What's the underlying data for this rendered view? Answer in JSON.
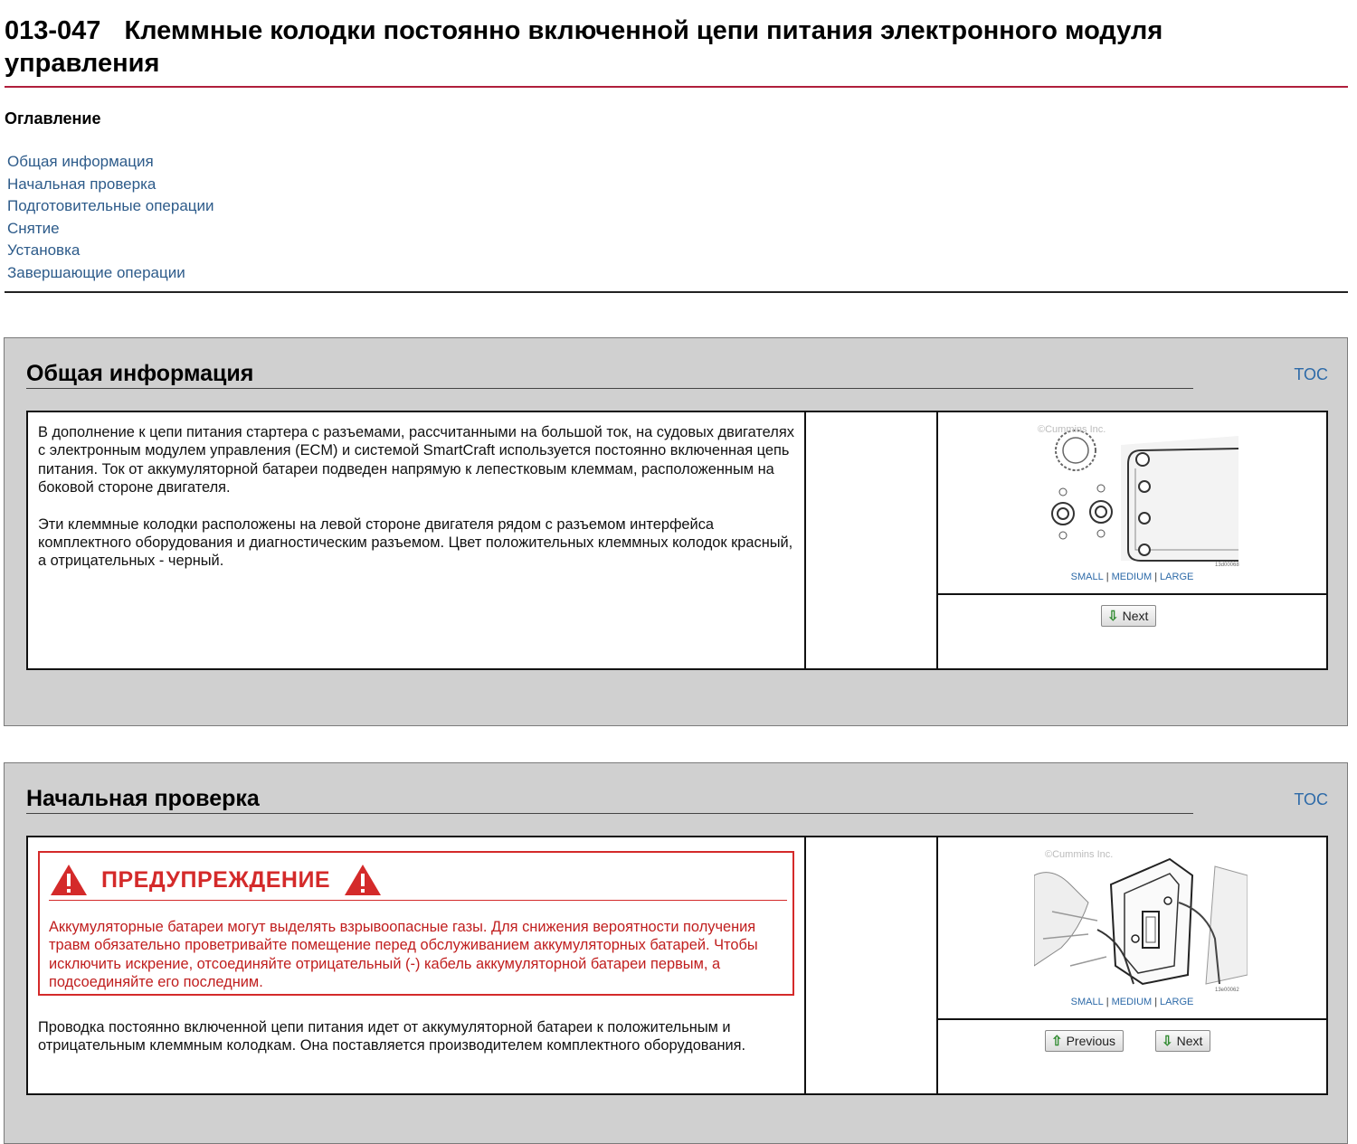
{
  "document": {
    "code": "013-047",
    "title": "Клеммные колодки постоянно включенной цепи питания электронного модуля управления"
  },
  "toc": {
    "heading": "Оглавление",
    "items": [
      {
        "label": "Общая информация"
      },
      {
        "label": "Начальная проверка"
      },
      {
        "label": "Подготовительные операции"
      },
      {
        "label": "Снятие"
      },
      {
        "label": "Установка"
      },
      {
        "label": "Завершающие операции"
      }
    ]
  },
  "sections": [
    {
      "title": "Общая информация",
      "toc_link": "TOC",
      "paragraphs": [
        "В дополнение к цепи питания стартера с разъемами, рассчитанными на большой ток, на судовых двигателях с электронным модулем управления (ECM) и системой SmartCraft используется постоянно включенная цепь питания. Ток от аккумуляторной батареи подведен напрямую к лепестковым клеммам, расположенным на боковой стороне двигателя.",
        "Эти клеммные колодки расположены на левой стороне двигателя рядом с разъемом интерфейса комплектного оборудования и диагностическим разъемом. Цвет положительных клеммных колодок красный, а отрицательных - черный."
      ],
      "figure": {
        "watermark": "©Cummins Inc.",
        "id": "13d00068"
      },
      "size_links": [
        "SMALL",
        "MEDIUM",
        "LARGE"
      ],
      "buttons": {
        "next": "Next"
      }
    },
    {
      "title": "Начальная проверка",
      "toc_link": "TOC",
      "warning": {
        "title": "ПРЕДУПРЕЖДЕНИЕ",
        "text": "Аккумуляторные батареи могут выделять взрывоопасные газы. Для снижения вероятности получения травм обязательно проветривайте помещение перед обслуживанием аккумуляторных батарей. Чтобы исключить искрение, отсоединяйте отрицательный (-) кабель аккумуляторной батареи первым, а подсоединяйте его последним."
      },
      "paragraphs": [
        "Проводка постоянно включенной цепи питания идет от аккумуляторной батареи к положительным и отрицательным клеммным колодкам. Она поставляется производителем комплектного оборудования."
      ],
      "figure": {
        "watermark": "©Cummins Inc.",
        "id": "13e00062"
      },
      "size_links": [
        "SMALL",
        "MEDIUM",
        "LARGE"
      ],
      "buttons": {
        "previous": "Previous",
        "next": "Next"
      }
    }
  ],
  "colors": {
    "accent_rule": "#b01e3c",
    "link": "#2d5b8a",
    "warning": "#d42a2a"
  },
  "icons": [
    "warning-triangle-icon",
    "arrow-down-icon",
    "arrow-up-icon"
  ]
}
